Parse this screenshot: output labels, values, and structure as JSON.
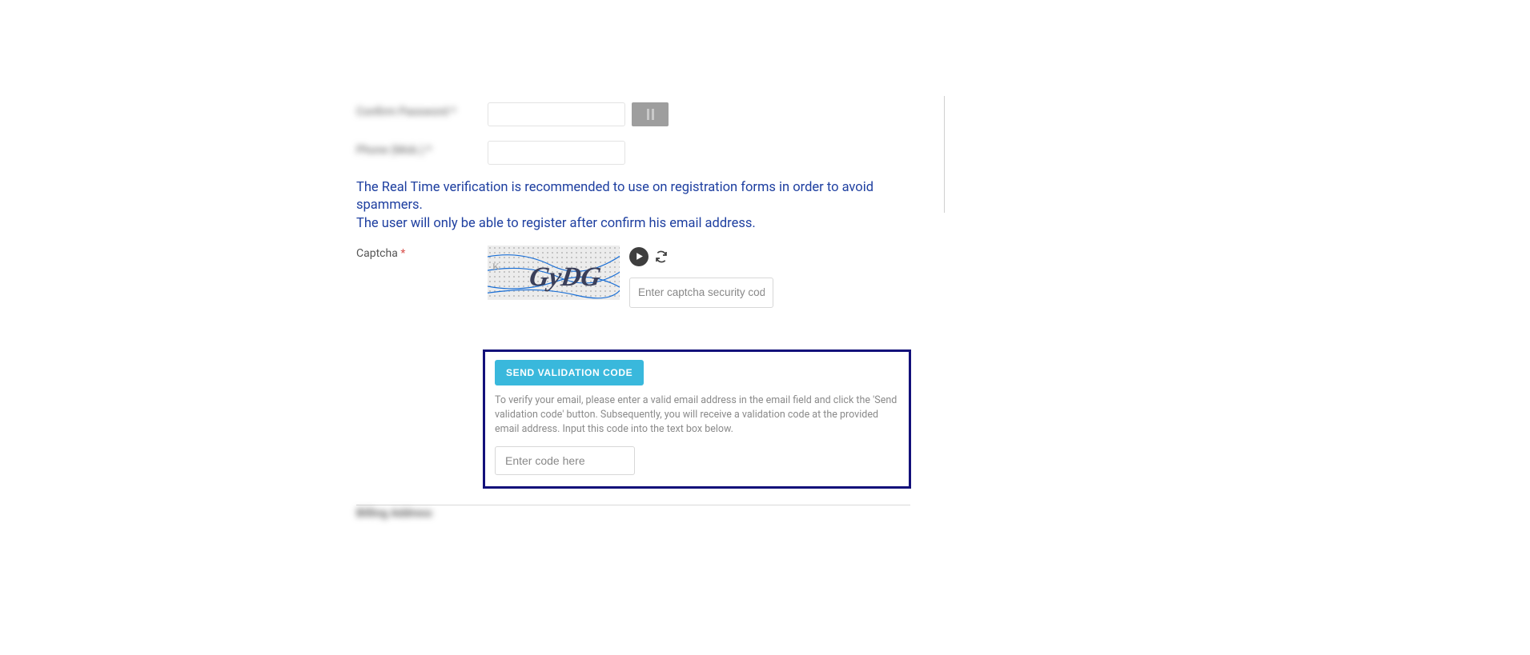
{
  "fields": {
    "confirm_password": {
      "label": "Confirm Password *",
      "value": ""
    },
    "phone": {
      "label": "Phone (Mob.) *",
      "value": ""
    }
  },
  "notice_line1": "The Real Time verification is recommended to use on registration forms in order to avoid spammers.",
  "notice_line2": "The user will only be able to register after confirm his email address.",
  "captcha": {
    "label": "Captcha",
    "asterisk": "*",
    "code_shown": "GyDG",
    "input_placeholder": "Enter captcha security code"
  },
  "validation": {
    "button": "SEND VALIDATION CODE",
    "help": "To verify your email, please enter a valid email address in the email field and click the 'Send validation code' button. Subsequently, you will receive a validation code at the provided email address. Input this code into the text box below.",
    "code_placeholder": "Enter code here"
  },
  "bottom_blur": "Billing Address"
}
